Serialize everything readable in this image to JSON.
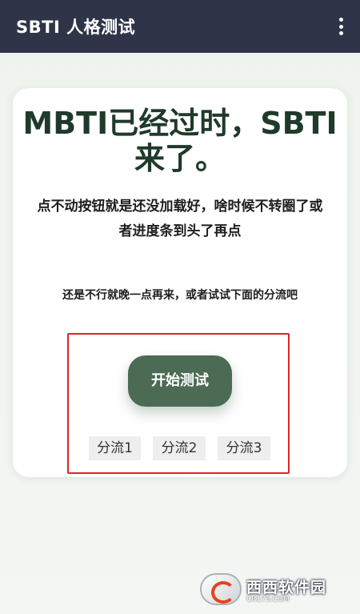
{
  "appbar": {
    "title": "SBTI 人格测试",
    "menu_icon": "more-vertical-icon"
  },
  "card": {
    "headline": "MBTI已经过时，SBTI来了。",
    "note1": "点不动按钮就是还没加载好，啥时候不转圈了或者进度条到头了再点",
    "note2": "还是不行就晚一点再来，或者试试下面的分流吧",
    "start_button": "开始测试",
    "splits": [
      "分流1",
      "分流2",
      "分流3"
    ]
  },
  "colors": {
    "appbar_bg": "#2f3448",
    "primary_button": "#4b6b55",
    "headline": "#1f3a2a",
    "highlight_border": "#e0232b"
  },
  "watermark": {
    "main": "西西软件园",
    "sub": "CR173.COM"
  }
}
